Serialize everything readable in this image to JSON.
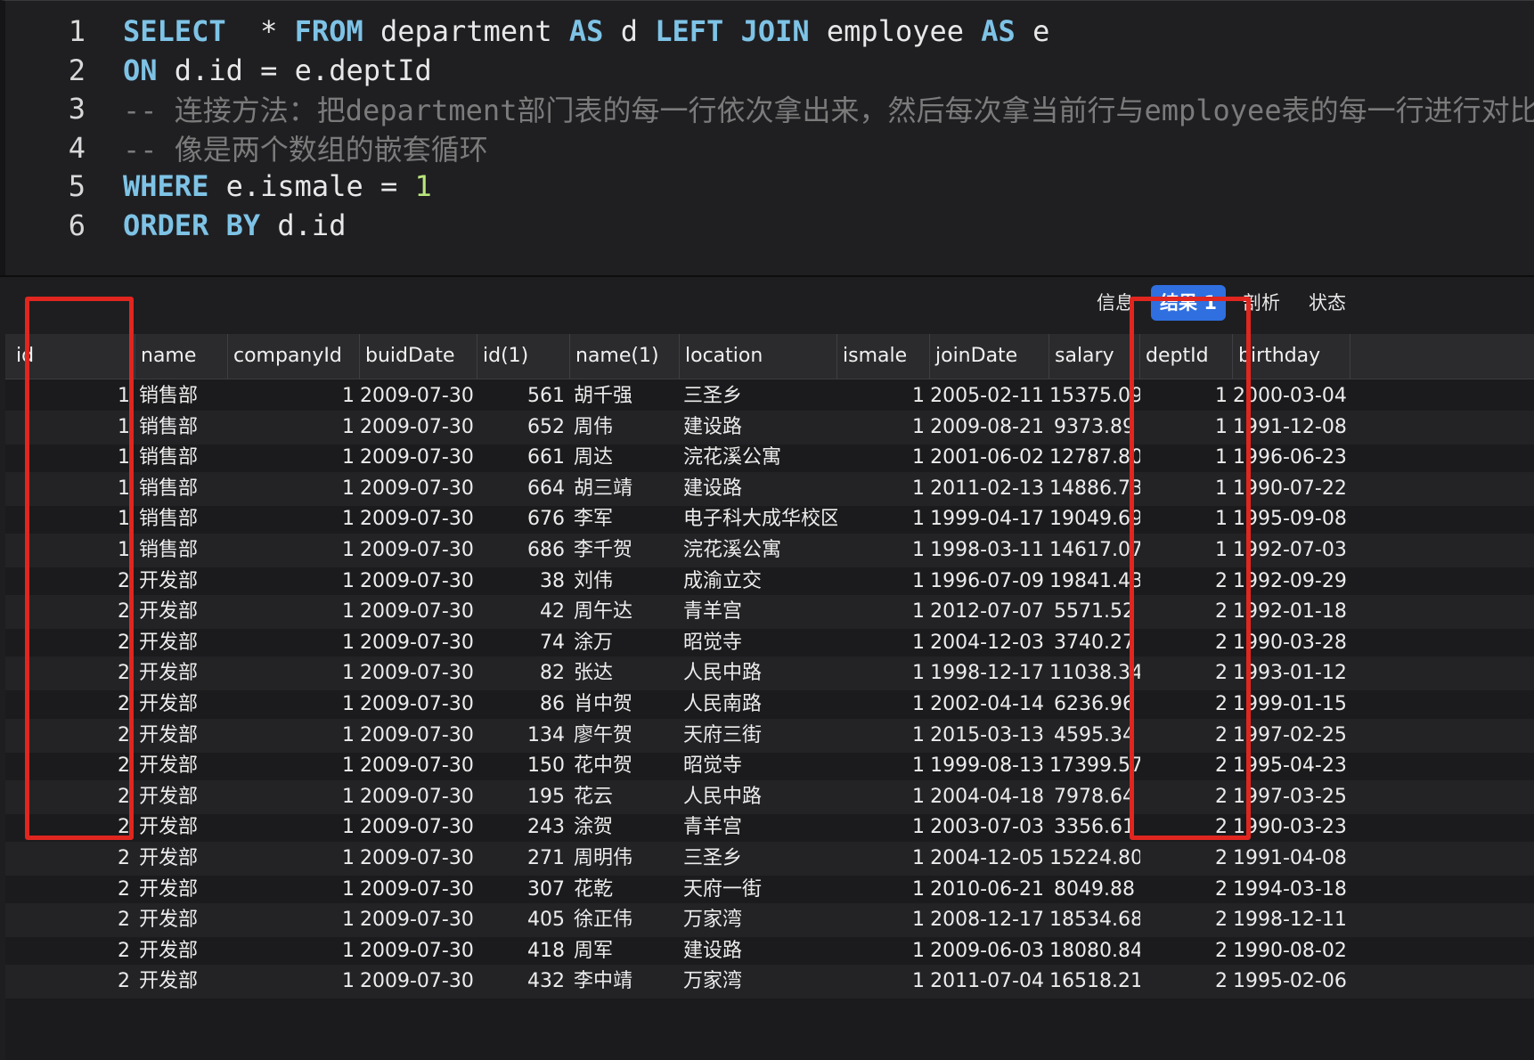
{
  "editor": {
    "lines": [
      {
        "no": "1",
        "parts": [
          [
            "kw",
            "SELECT"
          ],
          [
            "id",
            "  * "
          ],
          [
            "kw",
            "FROM"
          ],
          [
            "id",
            " department "
          ],
          [
            "kw",
            "AS"
          ],
          [
            "id",
            " d "
          ],
          [
            "kw",
            "LEFT JOIN"
          ],
          [
            "id",
            " employee "
          ],
          [
            "kw",
            "AS"
          ],
          [
            "id",
            " e"
          ]
        ]
      },
      {
        "no": "2",
        "parts": [
          [
            "kw",
            "ON"
          ],
          [
            "id",
            " d.id = e.deptId"
          ]
        ]
      },
      {
        "no": "3",
        "parts": [
          [
            "cm",
            "-- 连接方法：把department部门表的每一行依次拿出来，然后每次拿当前行与employee表的每一行进行对比,"
          ]
        ]
      },
      {
        "no": "4",
        "parts": [
          [
            "cm",
            "-- 像是两个数组的嵌套循环"
          ]
        ]
      },
      {
        "no": "5",
        "parts": [
          [
            "kw",
            "WHERE"
          ],
          [
            "id",
            " e.ismale = "
          ],
          [
            "num",
            "1"
          ]
        ]
      },
      {
        "no": "6",
        "parts": [
          [
            "kw",
            "ORDER BY"
          ],
          [
            "id",
            " d.id"
          ]
        ]
      }
    ]
  },
  "tabs": [
    "信息",
    "结果 1",
    "剖析",
    "状态"
  ],
  "active_tab": "结果 1",
  "columns": [
    "id",
    "name",
    "companyId",
    "buidDate",
    "id(1)",
    "name(1)",
    "location",
    "ismale",
    "joinDate",
    "salary",
    "deptId",
    "birthday"
  ],
  "rows": [
    [
      "1",
      "销售部",
      "1",
      "2009-07-30",
      "561",
      "胡千强",
      "三圣乡",
      "1",
      "2005-02-11",
      "15375.09",
      "1",
      "2000-03-04"
    ],
    [
      "1",
      "销售部",
      "1",
      "2009-07-30",
      "652",
      "周伟",
      "建设路",
      "1",
      "2009-08-21",
      "9373.89",
      "1",
      "1991-12-08"
    ],
    [
      "1",
      "销售部",
      "1",
      "2009-07-30",
      "661",
      "周达",
      "浣花溪公寓",
      "1",
      "2001-06-02",
      "12787.80",
      "1",
      "1996-06-23"
    ],
    [
      "1",
      "销售部",
      "1",
      "2009-07-30",
      "664",
      "胡三靖",
      "建设路",
      "1",
      "2011-02-13",
      "14886.73",
      "1",
      "1990-07-22"
    ],
    [
      "1",
      "销售部",
      "1",
      "2009-07-30",
      "676",
      "李军",
      "电子科大成华校区",
      "1",
      "1999-04-17",
      "19049.69",
      "1",
      "1995-09-08"
    ],
    [
      "1",
      "销售部",
      "1",
      "2009-07-30",
      "686",
      "李千贺",
      "浣花溪公寓",
      "1",
      "1998-03-11",
      "14617.07",
      "1",
      "1992-07-03"
    ],
    [
      "2",
      "开发部",
      "1",
      "2009-07-30",
      "38",
      "刘伟",
      "成渝立交",
      "1",
      "1996-07-09",
      "19841.43",
      "2",
      "1992-09-29"
    ],
    [
      "2",
      "开发部",
      "1",
      "2009-07-30",
      "42",
      "周午达",
      "青羊宫",
      "1",
      "2012-07-07",
      "5571.52",
      "2",
      "1992-01-18"
    ],
    [
      "2",
      "开发部",
      "1",
      "2009-07-30",
      "74",
      "涂万",
      "昭觉寺",
      "1",
      "2004-12-03",
      "3740.27",
      "2",
      "1990-03-28"
    ],
    [
      "2",
      "开发部",
      "1",
      "2009-07-30",
      "82",
      "张达",
      "人民中路",
      "1",
      "1998-12-17",
      "11038.34",
      "2",
      "1993-01-12"
    ],
    [
      "2",
      "开发部",
      "1",
      "2009-07-30",
      "86",
      "肖中贺",
      "人民南路",
      "1",
      "2002-04-14",
      "6236.96",
      "2",
      "1999-01-15"
    ],
    [
      "2",
      "开发部",
      "1",
      "2009-07-30",
      "134",
      "廖午贺",
      "天府三街",
      "1",
      "2015-03-13",
      "4595.34",
      "2",
      "1997-02-25"
    ],
    [
      "2",
      "开发部",
      "1",
      "2009-07-30",
      "150",
      "花中贺",
      "昭觉寺",
      "1",
      "1999-08-13",
      "17399.57",
      "2",
      "1995-04-23"
    ],
    [
      "2",
      "开发部",
      "1",
      "2009-07-30",
      "195",
      "花云",
      "人民中路",
      "1",
      "2004-04-18",
      "7978.64",
      "2",
      "1997-03-25"
    ],
    [
      "2",
      "开发部",
      "1",
      "2009-07-30",
      "243",
      "涂贺",
      "青羊宫",
      "1",
      "2003-07-03",
      "3356.61",
      "2",
      "1990-03-23"
    ],
    [
      "2",
      "开发部",
      "1",
      "2009-07-30",
      "271",
      "周明伟",
      "三圣乡",
      "1",
      "2004-12-05",
      "15224.80",
      "2",
      "1991-04-08"
    ],
    [
      "2",
      "开发部",
      "1",
      "2009-07-30",
      "307",
      "花乾",
      "天府一街",
      "1",
      "2010-06-21",
      "8049.88",
      "2",
      "1994-03-18"
    ],
    [
      "2",
      "开发部",
      "1",
      "2009-07-30",
      "405",
      "徐正伟",
      "万家湾",
      "1",
      "2008-12-17",
      "18534.68",
      "2",
      "1998-12-11"
    ],
    [
      "2",
      "开发部",
      "1",
      "2009-07-30",
      "418",
      "周军",
      "建设路",
      "1",
      "2009-06-03",
      "18080.84",
      "2",
      "1990-08-02"
    ],
    [
      "2",
      "开发部",
      "1",
      "2009-07-30",
      "432",
      "李中靖",
      "万家湾",
      "1",
      "2011-07-04",
      "16518.21",
      "2",
      "1995-02-06"
    ]
  ],
  "colors": {
    "highlight": "#e0261f",
    "active_tab": "#2f6fe0",
    "keyword": "#7ec3e6",
    "comment": "#7b7b7b",
    "number": "#b9e67c"
  }
}
